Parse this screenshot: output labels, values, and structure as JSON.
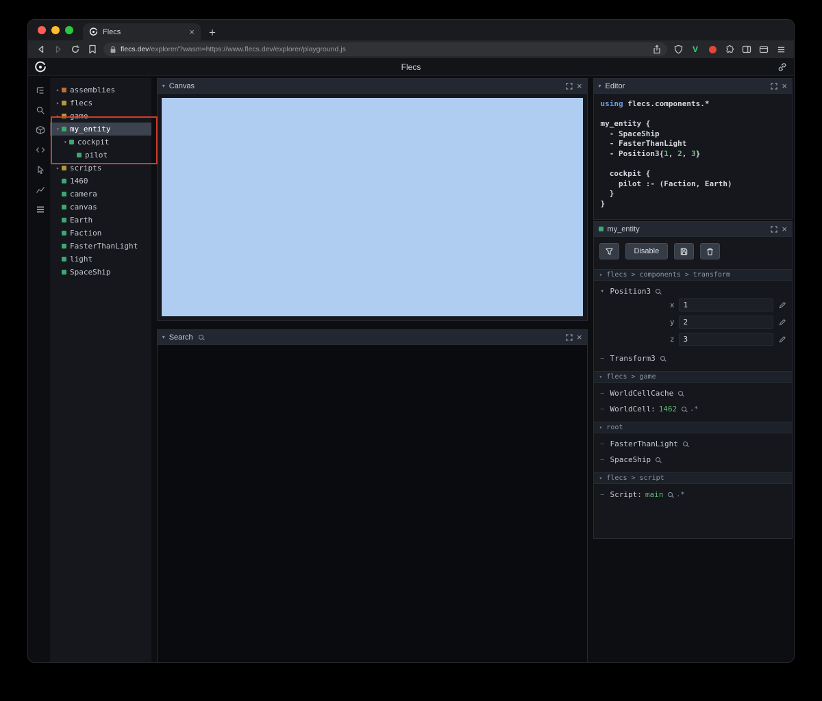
{
  "colors": {
    "entity_green": "#3da871",
    "module_yellow": "#b3983c",
    "assembly_orange": "#bf6e3a",
    "annotation_red": "#d23b27",
    "canvas_blue": "#aecdf1",
    "code_keyword": "#6d9ce6",
    "code_number": "#74c287",
    "value_green": "#5fb874"
  },
  "browser": {
    "tab": {
      "title": "Flecs"
    },
    "url": {
      "domain": "flecs.dev",
      "path": "/explorer/?wasm=https://www.flecs.dev/explorer/playground.js"
    }
  },
  "header": {
    "title": "Flecs"
  },
  "panels": {
    "canvas": "Canvas",
    "search": "Search",
    "editor": "Editor"
  },
  "tree": {
    "items": [
      {
        "label": "assemblies",
        "color": "assembly_orange",
        "expanded": false,
        "indent": 0
      },
      {
        "label": "flecs",
        "color": "module_yellow",
        "expanded": false,
        "indent": 0
      },
      {
        "label": "game",
        "color": "module_yellow",
        "expanded": false,
        "indent": 0
      },
      {
        "label": "my_entity",
        "color": "entity_green",
        "expanded": true,
        "indent": 0,
        "selected": true
      },
      {
        "label": "cockpit",
        "color": "entity_green",
        "expanded": true,
        "indent": 1
      },
      {
        "label": "pilot",
        "color": "entity_green",
        "indent": 2
      },
      {
        "label": "scripts",
        "color": "module_yellow",
        "expanded": false,
        "indent": 0
      },
      {
        "label": "1460",
        "color": "entity_green",
        "indent": 0
      },
      {
        "label": "camera",
        "color": "entity_green",
        "indent": 0
      },
      {
        "label": "canvas",
        "color": "entity_green",
        "indent": 0
      },
      {
        "label": "Earth",
        "color": "entity_green",
        "indent": 0
      },
      {
        "label": "Faction",
        "color": "entity_green",
        "indent": 0
      },
      {
        "label": "FasterThanLight",
        "color": "entity_green",
        "indent": 0
      },
      {
        "label": "light",
        "color": "entity_green",
        "indent": 0
      },
      {
        "label": "SpaceShip",
        "color": "entity_green",
        "indent": 0
      }
    ]
  },
  "editor": {
    "lines": [
      [
        {
          "t": "using",
          "c": "kw"
        },
        {
          "t": " flecs.components.*",
          "c": "d"
        }
      ],
      [],
      [
        {
          "t": "my_entity {",
          "c": "d"
        }
      ],
      [
        {
          "t": "  - SpaceShip",
          "c": "d"
        }
      ],
      [
        {
          "t": "  - FasterThanLight",
          "c": "d"
        }
      ],
      [
        {
          "t": "  - Position3{",
          "c": "d"
        },
        {
          "t": "1",
          "c": "num"
        },
        {
          "t": ", ",
          "c": "d"
        },
        {
          "t": "2",
          "c": "num"
        },
        {
          "t": ", ",
          "c": "d"
        },
        {
          "t": "3",
          "c": "num"
        },
        {
          "t": "}",
          "c": "d"
        }
      ],
      [],
      [
        {
          "t": "  cockpit {",
          "c": "d"
        }
      ],
      [
        {
          "t": "    pilot :- (Faction, Earth)",
          "c": "d"
        }
      ],
      [
        {
          "t": "  }",
          "c": "d"
        }
      ],
      [
        {
          "t": "}",
          "c": "d"
        }
      ]
    ]
  },
  "inspector": {
    "title": "my_entity",
    "toolbar": {
      "disable": "Disable"
    },
    "groups": [
      {
        "breadcrumb": [
          "flecs",
          "components",
          "transform"
        ],
        "items": [
          {
            "name": "Position3",
            "expanded": true,
            "fields": [
              {
                "label": "x",
                "value": "1"
              },
              {
                "label": "y",
                "value": "2"
              },
              {
                "label": "z",
                "value": "3"
              }
            ]
          },
          {
            "name": "Transform3"
          }
        ]
      },
      {
        "breadcrumb": [
          "flecs",
          "game"
        ],
        "items": [
          {
            "name": "WorldCellCache"
          },
          {
            "name": "WorldCell",
            "value": "1462",
            "suffix": ".*"
          }
        ]
      },
      {
        "breadcrumb": [
          "root"
        ],
        "items": [
          {
            "name": "FasterThanLight"
          },
          {
            "name": "SpaceShip"
          }
        ]
      },
      {
        "breadcrumb": [
          "flecs",
          "script"
        ],
        "items": [
          {
            "name": "Script",
            "value": "main",
            "suffix": ".*"
          }
        ]
      }
    ]
  }
}
